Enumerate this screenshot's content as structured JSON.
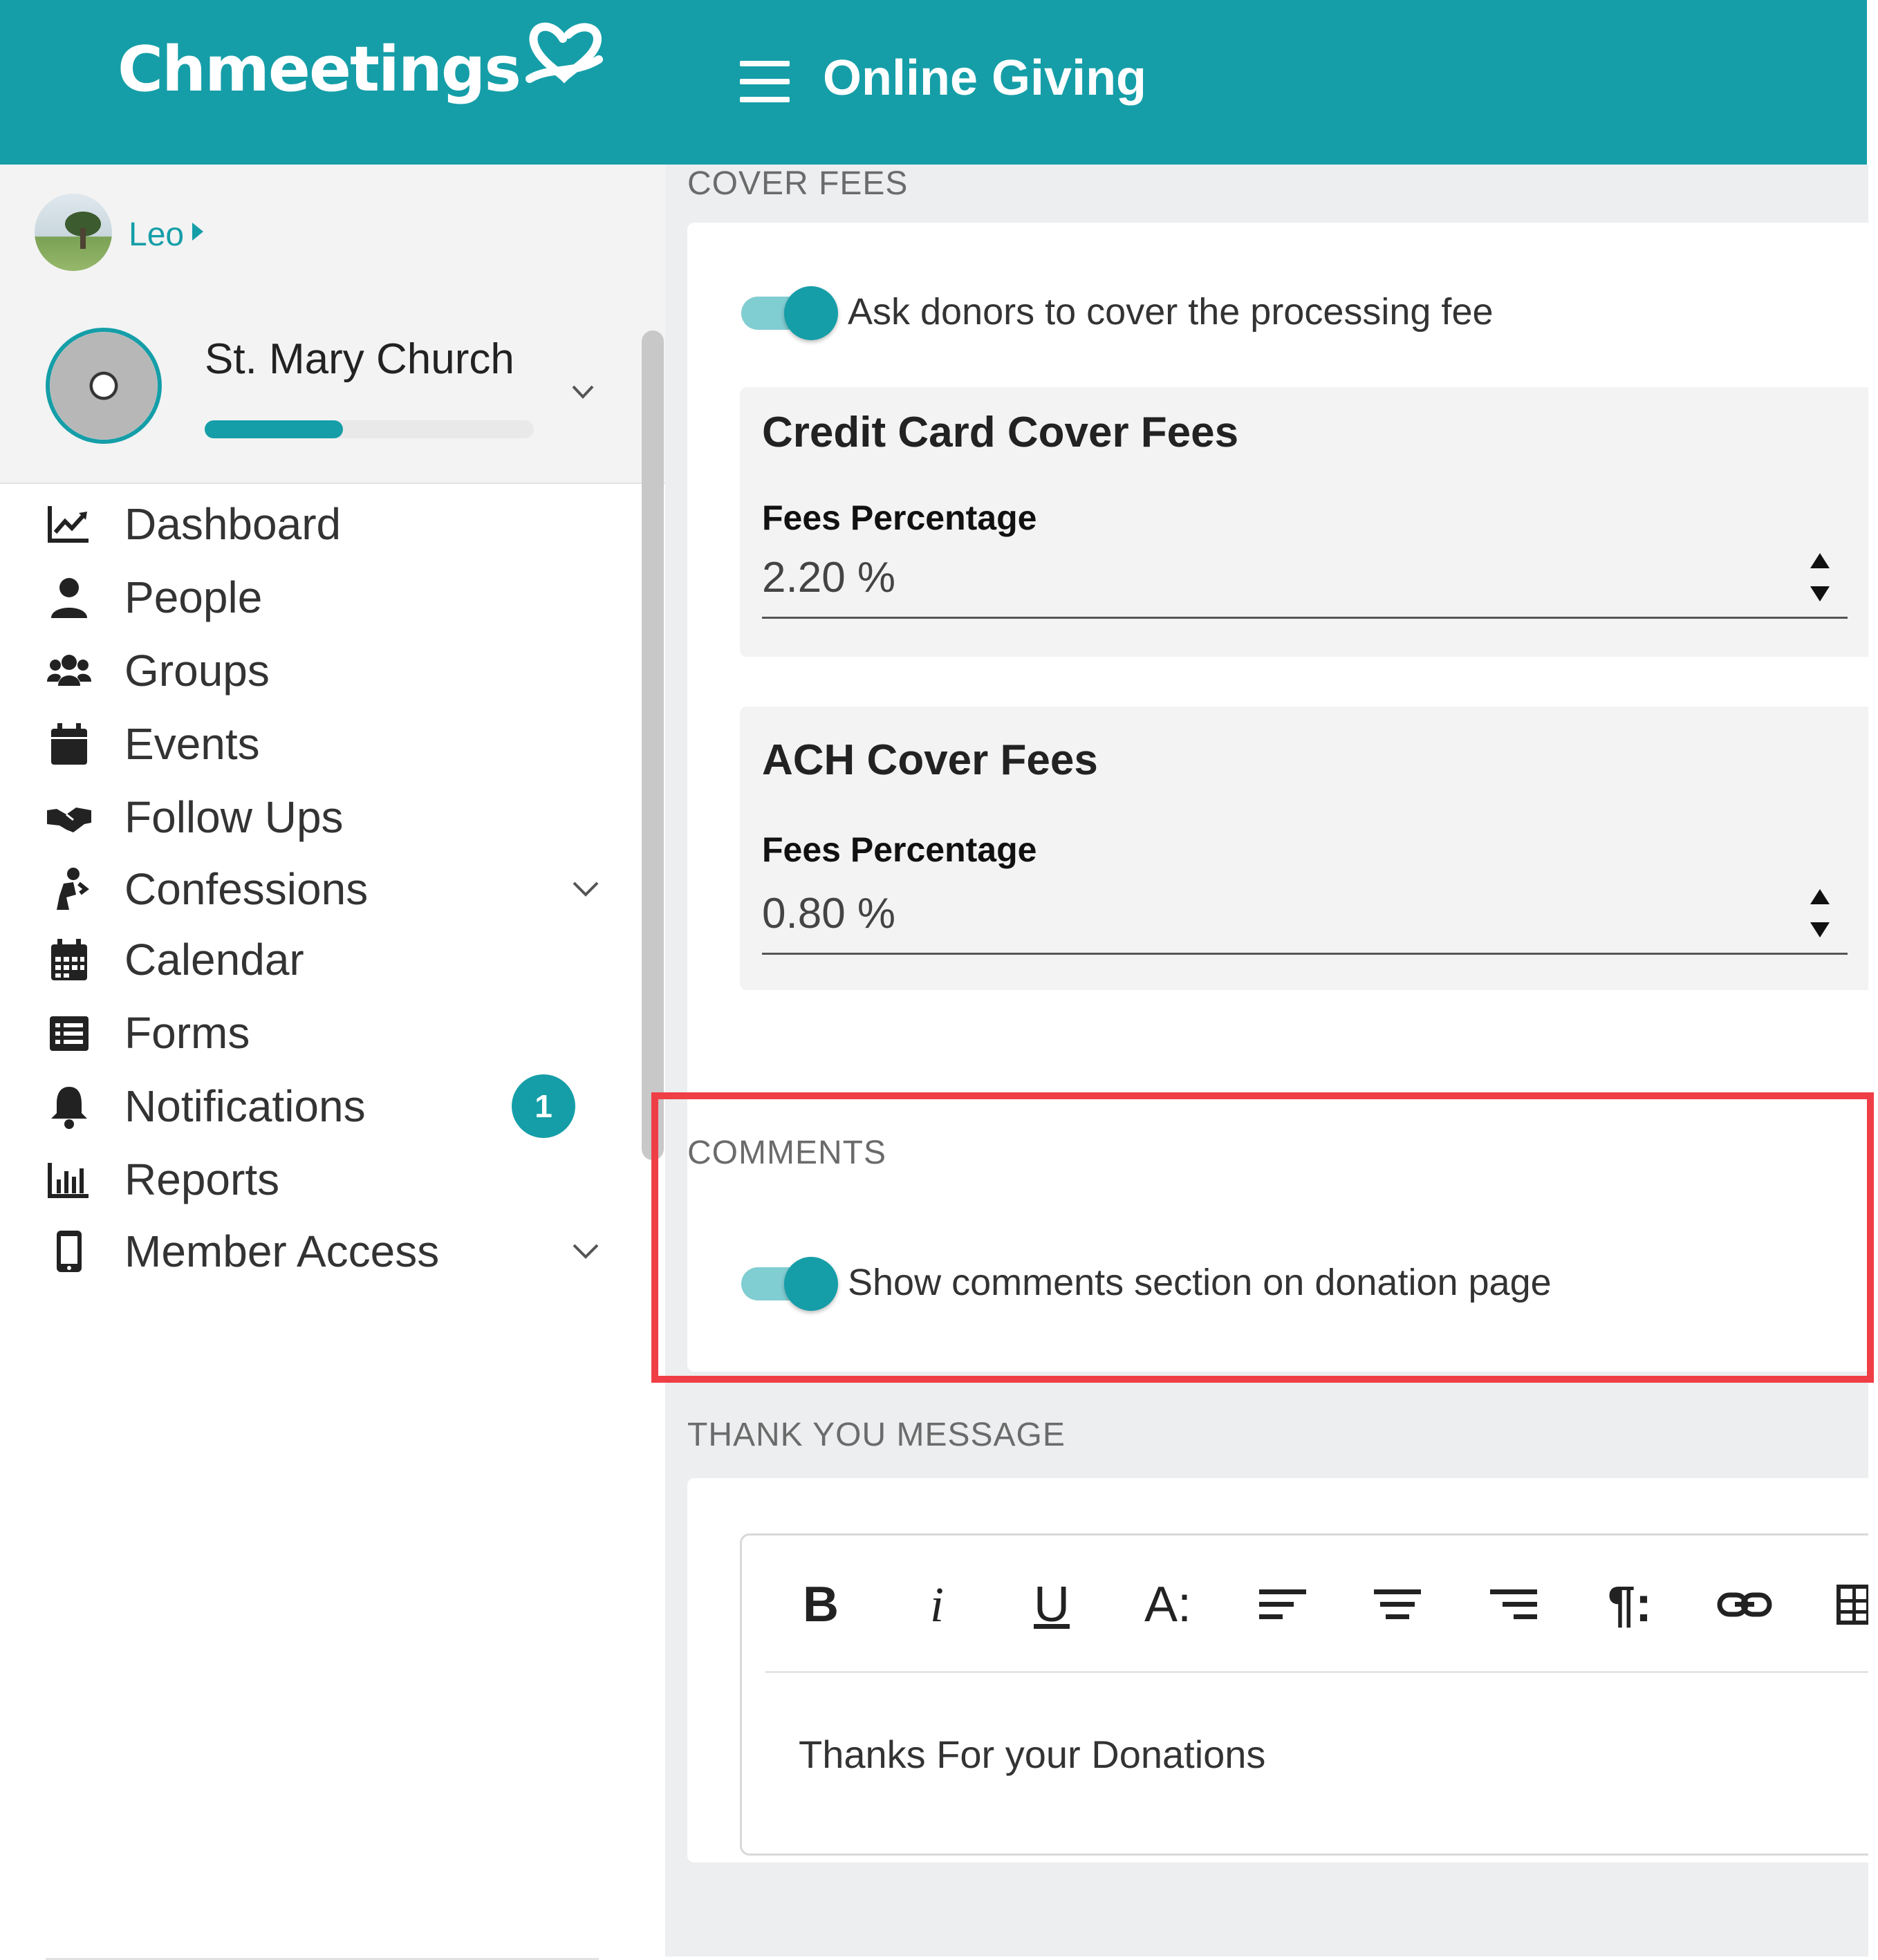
{
  "header": {
    "logo_text": "Chmeetings",
    "title": "Online Giving",
    "menu_icon": "hamburger-icon",
    "background": "#159ea8"
  },
  "sidebar": {
    "user": {
      "name": "Leo"
    },
    "church": {
      "name": "St. Mary Church",
      "progress_percent": 42
    },
    "nav_items": [
      {
        "label": "Dashboard",
        "icon": "chart-line-icon"
      },
      {
        "label": "People",
        "icon": "user-icon"
      },
      {
        "label": "Groups",
        "icon": "users-icon"
      },
      {
        "label": "Events",
        "icon": "calendar-icon"
      },
      {
        "label": "Follow Ups",
        "icon": "handshake-icon"
      },
      {
        "label": "Confessions",
        "icon": "praying-icon",
        "expandable": true
      },
      {
        "label": "Calendar",
        "icon": "calendar-grid-icon"
      },
      {
        "label": "Forms",
        "icon": "list-icon"
      },
      {
        "label": "Notifications",
        "icon": "bell-icon",
        "badge": "1"
      },
      {
        "label": "Reports",
        "icon": "bar-chart-icon"
      },
      {
        "label": "Member Access",
        "icon": "mobile-icon",
        "expandable": true
      }
    ]
  },
  "cover_fees": {
    "section_title": "COVER FEES",
    "toggle_label": "Ask donors to cover the processing fee",
    "toggle_on": true,
    "credit_card": {
      "title": "Credit Card Cover Fees",
      "field_label": "Fees Percentage",
      "value": "2.20 %"
    },
    "ach": {
      "title": "ACH Cover Fees",
      "field_label": "Fees Percentage",
      "value": "0.80 %"
    }
  },
  "comments": {
    "section_title": "COMMENTS",
    "toggle_label": "Show comments section on donation page",
    "toggle_on": true,
    "highlight_color": "#ef3e45"
  },
  "thank_you": {
    "section_title": "THANK YOU MESSAGE",
    "toolbar": [
      {
        "label": "B",
        "icon": "bold-icon"
      },
      {
        "label": "i",
        "icon": "italic-icon"
      },
      {
        "label": "U",
        "icon": "underline-icon"
      },
      {
        "label": "A:",
        "icon": "font-size-icon"
      },
      {
        "label": "",
        "icon": "align-left-icon"
      },
      {
        "label": "",
        "icon": "align-center-icon"
      },
      {
        "label": "",
        "icon": "align-right-icon"
      },
      {
        "label": "¶:",
        "icon": "paragraph-icon"
      },
      {
        "label": "",
        "icon": "link-icon"
      },
      {
        "label": "",
        "icon": "table-icon"
      }
    ],
    "message": "Thanks For your Donations"
  }
}
